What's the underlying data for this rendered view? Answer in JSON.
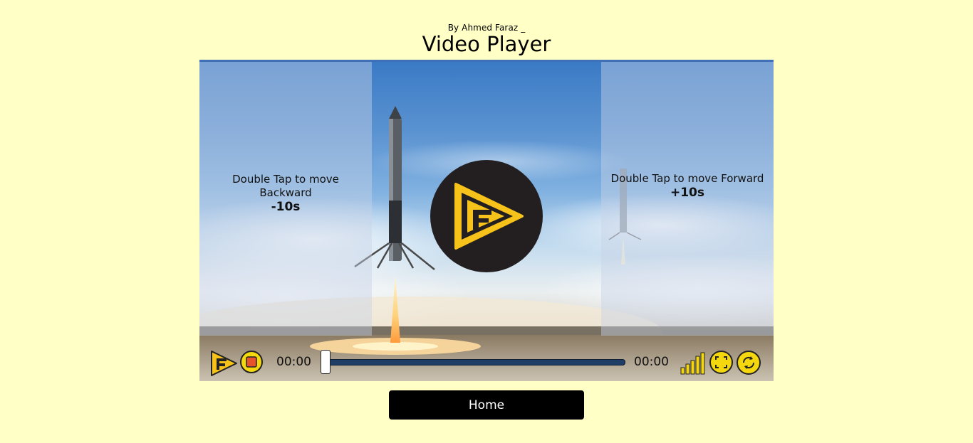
{
  "header": {
    "byline": "By Ahmed Faraz _",
    "title": "Video Player"
  },
  "player": {
    "backward_hint": "Double Tap to move Backward",
    "backward_amount": "-10s",
    "forward_hint": "Double Tap to move Forward",
    "forward_amount": "+10s",
    "center_logo_icon": "play-logo-icon",
    "controls": {
      "current_time": "00:00",
      "duration": "00:00",
      "progress": 0,
      "icons": [
        "play-logo-icon",
        "stop-icon",
        "volume-bars-icon",
        "fullscreen-icon",
        "rotate-icon"
      ]
    }
  },
  "footer": {
    "home_label": "Home"
  },
  "colors": {
    "page_background": "#ffffc6",
    "accent_yellow": "#f5d70e",
    "stop_red": "#e8542a",
    "track_blue": "#3a78c0",
    "button_black": "#000000"
  }
}
